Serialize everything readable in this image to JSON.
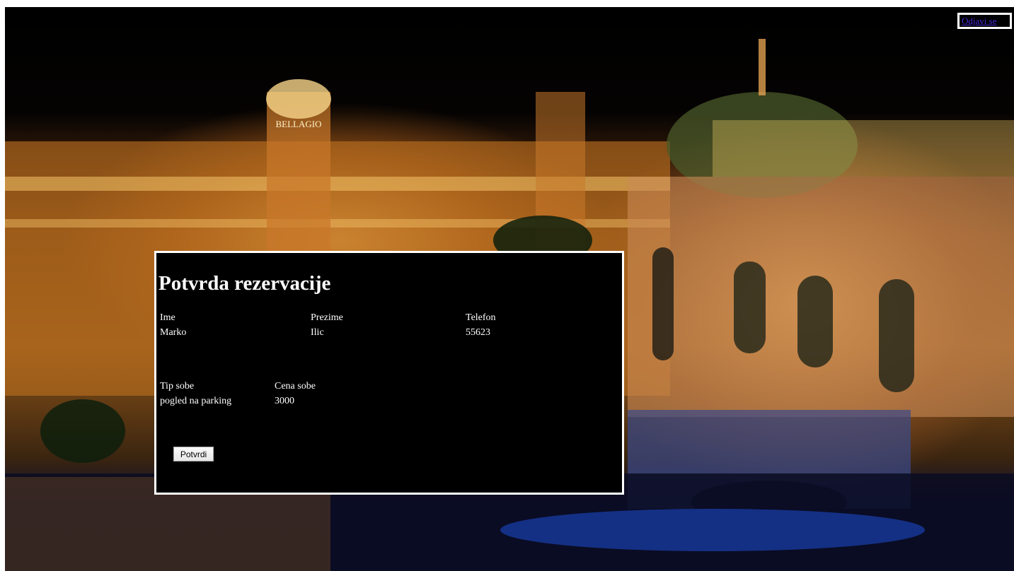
{
  "header": {
    "logout_link": "Odjavi se"
  },
  "reservation": {
    "title": "Potvrda rezervacije",
    "guest_headers": [
      "Ime",
      "Prezime",
      "Telefon"
    ],
    "guest_values": [
      "Marko",
      "Ilic",
      "55623"
    ],
    "room_headers": [
      "Tip sobe",
      "Cena sobe"
    ],
    "room_values": [
      "pogled na parking",
      "3000"
    ],
    "confirm_button": "Potvrdi"
  },
  "background": {
    "sign_text": "BELLAGIO",
    "colors": {
      "sky": "#000000",
      "building_light": "#f0a94a",
      "water_blue": "#1e4fd6",
      "panel": "#000000",
      "panel_border": "#ffffff",
      "link": "#4b2ad9"
    }
  }
}
